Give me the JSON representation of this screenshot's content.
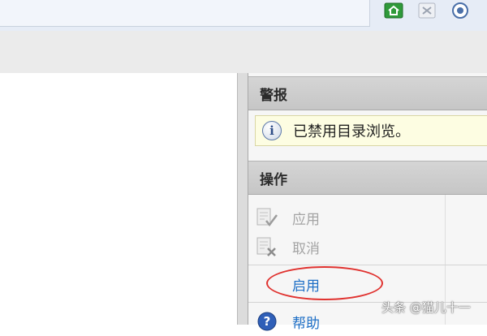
{
  "alerts": {
    "header": "警报",
    "message": "已禁用目录浏览。",
    "icon": "info-icon"
  },
  "actions": {
    "header": "操作",
    "items": [
      {
        "label": "应用",
        "icon": "apply-icon",
        "enabled": false
      },
      {
        "label": "取消",
        "icon": "cancel-icon",
        "enabled": false
      },
      {
        "label": "启用",
        "icon": "",
        "enabled": true
      },
      {
        "label": "帮助",
        "icon": "help-icon",
        "enabled": true
      }
    ]
  },
  "toolbar": {
    "icons": [
      "home-icon",
      "close-icon",
      "help-icon"
    ]
  },
  "watermark": "头条 @猫儿十一",
  "colors": {
    "link": "#1e6fc6",
    "highlight_ellipse": "#e0322f",
    "alert_background": "#fdfde2",
    "section_header": "#c8c8c8"
  }
}
